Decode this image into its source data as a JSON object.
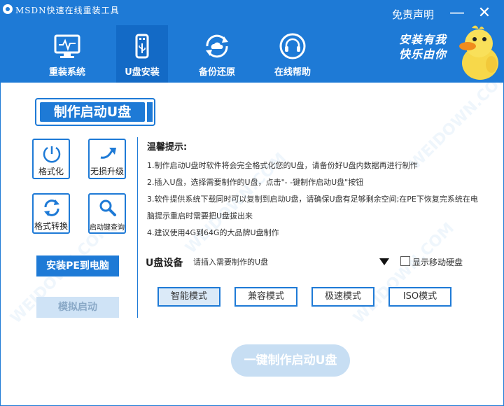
{
  "app": {
    "title": "MSDN快速在线重装工具",
    "disclaimer": "免责声明",
    "minimize": "—",
    "close": "✕"
  },
  "nav": {
    "tabs": [
      {
        "label": "重装系统",
        "icon": "monitor-icon"
      },
      {
        "label": "U盘安装",
        "icon": "usb-drive-icon"
      },
      {
        "label": "备份还原",
        "icon": "cloud-sync-icon"
      },
      {
        "label": "在线帮助",
        "icon": "headset-icon"
      }
    ],
    "active_index": 1
  },
  "mascot": {
    "line1": "安装有我",
    "line2": "快乐由你"
  },
  "section": {
    "title": "制作启动U盘"
  },
  "tools": [
    {
      "label": "格式化",
      "icon": "format-icon"
    },
    {
      "label": "无损升级",
      "icon": "upgrade-icon"
    },
    {
      "label": "格式转换",
      "icon": "convert-icon"
    },
    {
      "label": "启动键查询",
      "icon": "search-icon"
    }
  ],
  "actions": {
    "install_pe": "安装PE到电脑",
    "simulate_boot": "模拟启动",
    "make_usb": "一键制作启动U盘"
  },
  "tips": {
    "title": "温馨提示:",
    "lines": [
      "1.制作启动U盘时软件将会完全格式化您的U盘，请备份好U盘内数据再进行制作",
      "2.插入U盘，选择需要制作的U盘，点击\"- -键制作启动U盘\"按钮",
      "3.软件提供系统下载同时可以复制到启动U盘，请确保U盘有足够剩余空间;在PE下恢复完系统在电",
      "脑提示重启时需要把U盘拔出来",
      "4.建议使用4G到64G的大品牌U盘制作"
    ]
  },
  "usb": {
    "label": "U盘设备",
    "placeholder": "请插入需要制作的U盘",
    "show_hdd": "显示移动硬盘",
    "show_hdd_checked": false
  },
  "modes": [
    "智能模式",
    "兼容模式",
    "极速模式",
    "ISO模式"
  ],
  "active_mode": 0,
  "colors": {
    "brand": "#1e7ad6",
    "brand_dark": "#136ac6",
    "disabled": "#c7def3"
  },
  "watermark": "WEIDOWN.COM"
}
